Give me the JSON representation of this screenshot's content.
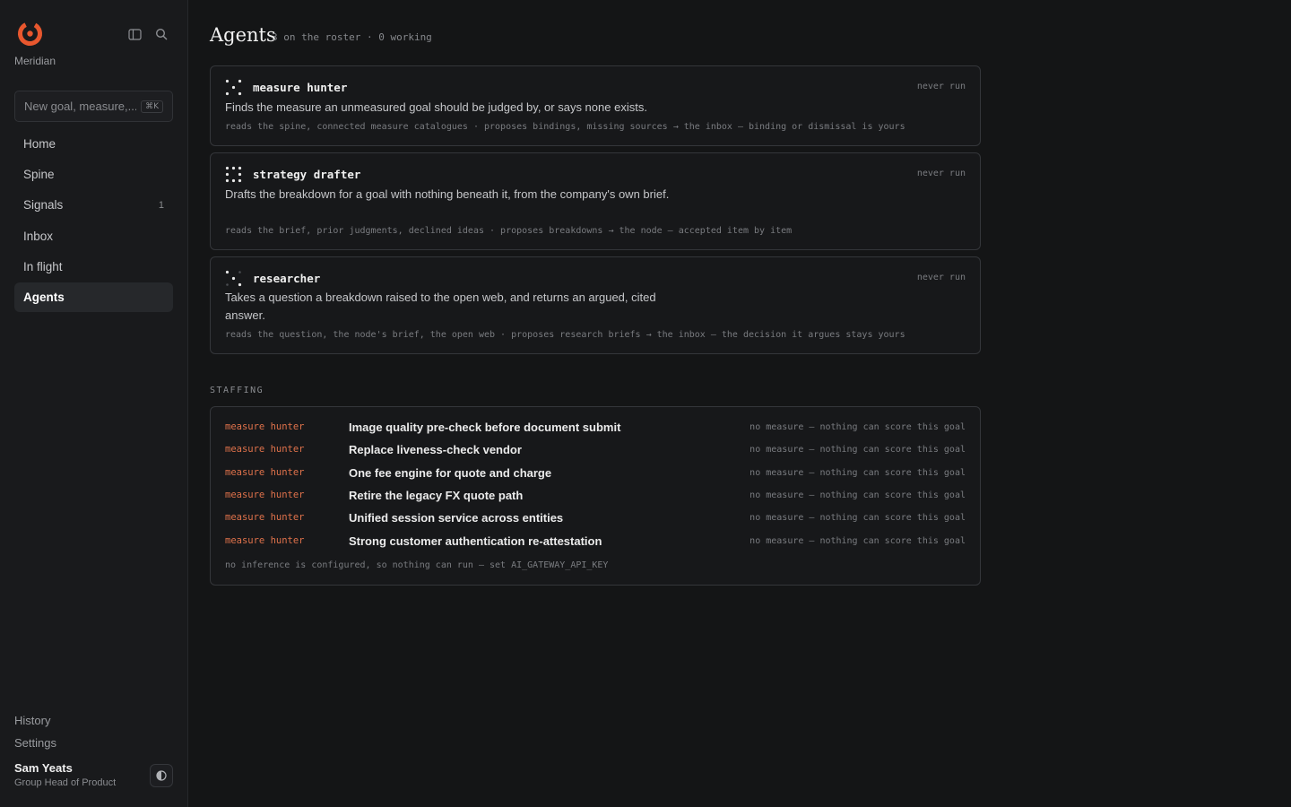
{
  "sidebar": {
    "brand": "Meridian",
    "search_placeholder": "New goal, measure,...",
    "search_shortcut": "⌘K",
    "nav": [
      {
        "label": "Home",
        "count": ""
      },
      {
        "label": "Spine",
        "count": ""
      },
      {
        "label": "Signals",
        "count": "1"
      },
      {
        "label": "Inbox",
        "count": ""
      },
      {
        "label": "In flight",
        "count": ""
      },
      {
        "label": "Agents",
        "count": "",
        "active": true
      }
    ],
    "history_label": "History",
    "settings_label": "Settings",
    "user": {
      "name": "Sam Yeats",
      "role": "Group Head of Product"
    }
  },
  "main": {
    "title": "Agents",
    "subtitle": "3 on the roster · 0 working",
    "agents": [
      {
        "name": "measure hunter",
        "status": "never run",
        "description": "Finds the measure an unmeasured goal should be judged by, or says none exists.",
        "meta": "reads the spine, connected measure catalogues · proposes bindings, missing sources → the inbox — binding or dismissal is yours"
      },
      {
        "name": "strategy drafter",
        "status": "never run",
        "description": "Drafts the breakdown for a goal with nothing beneath it, from the company's own brief.",
        "meta": "reads the brief, prior judgments, declined ideas · proposes breakdowns → the node — accepted item by item"
      },
      {
        "name": "researcher",
        "status": "never run",
        "description": "Takes a question a breakdown raised to the open web, and returns an argued, cited answer.",
        "meta": "reads the question, the node's brief, the open web · proposes research briefs → the inbox — the decision it argues stays yours"
      }
    ],
    "staffing_label": "STAFFING",
    "staffing": [
      {
        "agent": "measure hunter",
        "goal": "Image quality pre-check before document submit",
        "status": "no measure — nothing can score this goal"
      },
      {
        "agent": "measure hunter",
        "goal": "Replace liveness-check vendor",
        "status": "no measure — nothing can score this goal"
      },
      {
        "agent": "measure hunter",
        "goal": "One fee engine for quote and charge",
        "status": "no measure — nothing can score this goal"
      },
      {
        "agent": "measure hunter",
        "goal": "Retire the legacy FX quote path",
        "status": "no measure — nothing can score this goal"
      },
      {
        "agent": "measure hunter",
        "goal": "Unified session service across entities",
        "status": "no measure — nothing can score this goal"
      },
      {
        "agent": "measure hunter",
        "goal": "Strong customer authentication re-attestation",
        "status": "no measure — nothing can score this goal"
      }
    ],
    "staffing_footer": "no inference is configured, so nothing can run — set AI_GATEWAY_API_KEY"
  },
  "colors": {
    "accent": "#e8572e",
    "agent_label": "#e0724b",
    "background": "#141516",
    "sidebar": "#191a1c"
  },
  "icons": {
    "logo": "meridian-logo",
    "sidebar_toggle": "sidebar-toggle-icon",
    "search": "search-icon",
    "theme": "theme-contrast-icon",
    "agent": "dots-grid-icon"
  }
}
